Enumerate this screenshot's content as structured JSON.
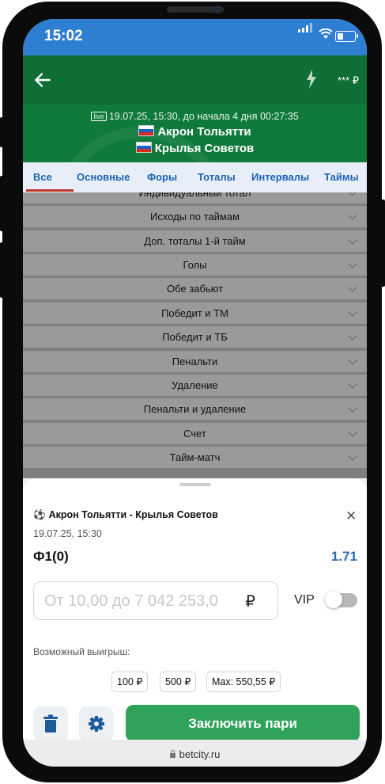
{
  "status_bar": {
    "time": "15:02"
  },
  "app_bar": {
    "balance": "*** ₽"
  },
  "match": {
    "live_badge": "live",
    "info": "19.07.25, 15:30, до начала  4 дня  00:27:35",
    "home_team": "Акрон Тольятти",
    "away_team": "Крылья Советов"
  },
  "tabs": [
    {
      "label": "Все",
      "active": true
    },
    {
      "label": "Основные"
    },
    {
      "label": "Форы"
    },
    {
      "label": "Тоталы"
    },
    {
      "label": "Интервалы"
    },
    {
      "label": "Таймы"
    }
  ],
  "markets": [
    "Индивидуальный тотал",
    "Исходы по таймам",
    "Доп. тоталы 1-й тайм",
    "Голы",
    "Обе забьют",
    "Победит и ТМ",
    "Победит и ТБ",
    "Пенальти",
    "Удаление",
    "Пенальти и удаление",
    "Счет",
    "Тайм-матч"
  ],
  "bet_slip": {
    "event": "Акрон Тольятти - Крылья Советов",
    "datetime": "19.07.25,  15:30",
    "selection": "Ф1(0)",
    "odds": "1.71",
    "stake_placeholder": "От 10,00 до 7 042 253,0",
    "currency": "₽",
    "vip_label": "VIP",
    "vip_enabled": false,
    "possible_win_label": "Возможный выигрыш:",
    "quick_amounts": [
      "100 ₽",
      "500 ₽",
      "Max: 550,55 ₽"
    ],
    "place_bet_label": "Заключить пари"
  },
  "browser": {
    "url": "betcity.ru"
  },
  "colors": {
    "status_bar": "#2e7fd1",
    "app_bar": "#0f6e35",
    "match_header": "#107a3c",
    "tab_text": "#1e63b6",
    "active_tab_underline": "#c0392b",
    "odds": "#2b6cad",
    "place_bet_button": "#2fa35a"
  }
}
